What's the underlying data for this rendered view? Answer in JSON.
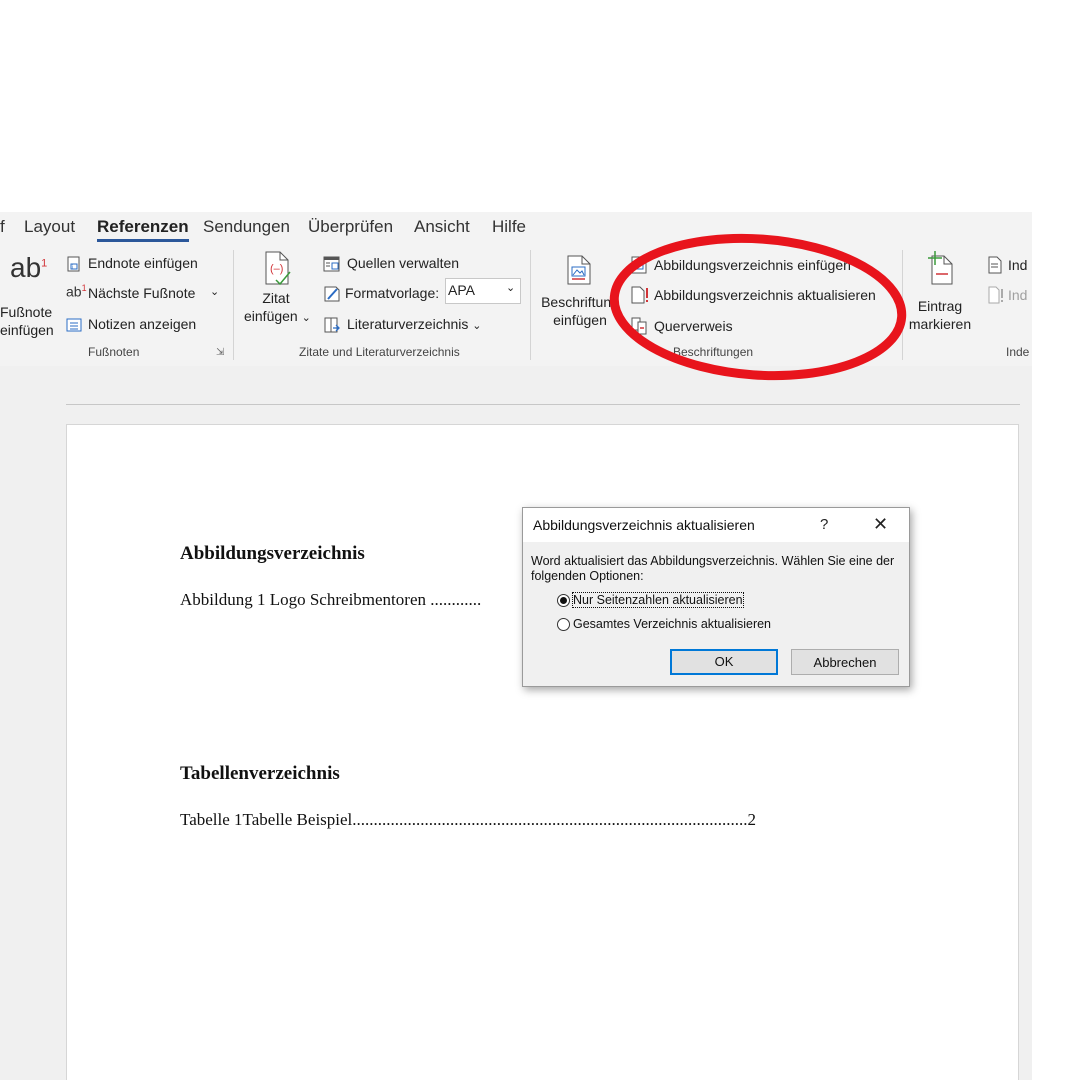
{
  "tabs": [
    {
      "label": "f",
      "active": false
    },
    {
      "label": "Layout",
      "active": false
    },
    {
      "label": "Referenzen",
      "active": true
    },
    {
      "label": "Sendungen",
      "active": false
    },
    {
      "label": "Überprüfen",
      "active": false
    },
    {
      "label": "Ansicht",
      "active": false
    },
    {
      "label": "Hilfe",
      "active": false
    }
  ],
  "ribbon": {
    "footnotes": {
      "big_icon_text": "ab",
      "big_icon_sup": "1",
      "big_button_line1": "Fußnote",
      "big_button_line2": "einfügen",
      "endnote": "Endnote einfügen",
      "next_footnote": "Nächste Fußnote",
      "show_notes": "Notizen anzeigen",
      "group_label": "Fußnoten"
    },
    "citations": {
      "insert_citation_line1": "Zitat",
      "insert_citation_line2": "einfügen",
      "manage_sources": "Quellen verwalten",
      "style_label": "Formatvorlage:",
      "style_value": "APA",
      "bibliography": "Literaturverzeichnis",
      "group_label": "Zitate und Literaturverzeichnis"
    },
    "captions": {
      "insert_caption_line1": "Beschriftung",
      "insert_caption_line2": "einfügen",
      "insert_table_of_figures": "Abbildungsverzeichnis einfügen",
      "update_table": "Abbildungsverzeichnis aktualisieren",
      "cross_reference": "Querverweis",
      "group_label": "Beschriftungen"
    },
    "index": {
      "mark_entry_line1": "Eintrag",
      "mark_entry_line2": "markieren",
      "insert_index": "Ind",
      "update_index": "Ind",
      "group_label": "Inde"
    }
  },
  "document": {
    "figures_heading": "Abbildungsverzeichnis",
    "figures_entry_text": "Abbildung 1 Logo Schreibmentoren",
    "figures_entry_dots": "............",
    "tables_heading": "Tabellenverzeichnis",
    "tables_entry_text": "Tabelle 1Tabelle Beispiel",
    "tables_entry_dots": ".............................................................................................",
    "tables_entry_page": "2"
  },
  "dialog": {
    "title": "Abbildungsverzeichnis aktualisieren",
    "help": "?",
    "close": "✕",
    "message": "Word aktualisiert das Abbildungsverzeichnis. Wählen Sie eine der folgenden Optionen:",
    "option1": "Nur Seitenzahlen aktualisieren",
    "option2": "Gesamtes Verzeichnis aktualisieren",
    "selected_option": 1,
    "ok": "OK",
    "cancel": "Abbrechen"
  },
  "annotation": {
    "color": "#e8141c"
  },
  "accent": "#2b579a"
}
